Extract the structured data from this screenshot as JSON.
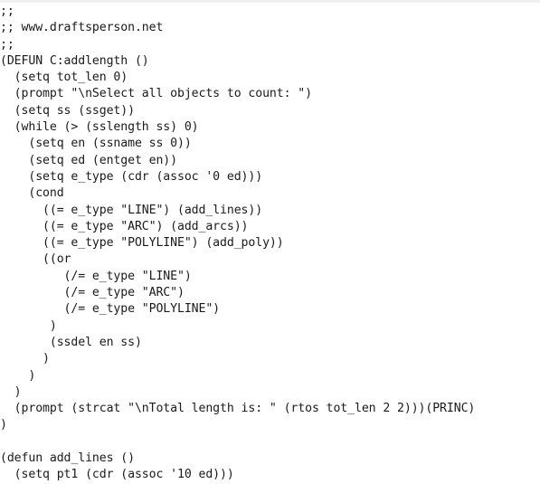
{
  "editor": {
    "lines": [
      ";;",
      ";; www.draftsperson.net",
      ";;",
      "(DEFUN C:addlength ()",
      "  (setq tot_len 0)",
      "  (prompt \"\\nSelect all objects to count: \")",
      "  (setq ss (ssget))",
      "  (while (> (sslength ss) 0)",
      "    (setq en (ssname ss 0))",
      "    (setq ed (entget en))",
      "    (setq e_type (cdr (assoc '0 ed)))",
      "    (cond",
      "      ((= e_type \"LINE\") (add_lines))",
      "      ((= e_type \"ARC\") (add_arcs))",
      "      ((= e_type \"POLYLINE\") (add_poly))",
      "      ((or",
      "         (/= e_type \"LINE\")",
      "         (/= e_type \"ARC\")",
      "         (/= e_type \"POLYLINE\")",
      "       )",
      "       (ssdel en ss)",
      "      )",
      "    )",
      "  )",
      "  (prompt (strcat \"\\nTotal length is: \" (rtos tot_len 2 2)))(PRINC)",
      ")",
      "",
      "(defun add_lines ()",
      "  (setq pt1 (cdr (assoc '10 ed)))"
    ]
  }
}
